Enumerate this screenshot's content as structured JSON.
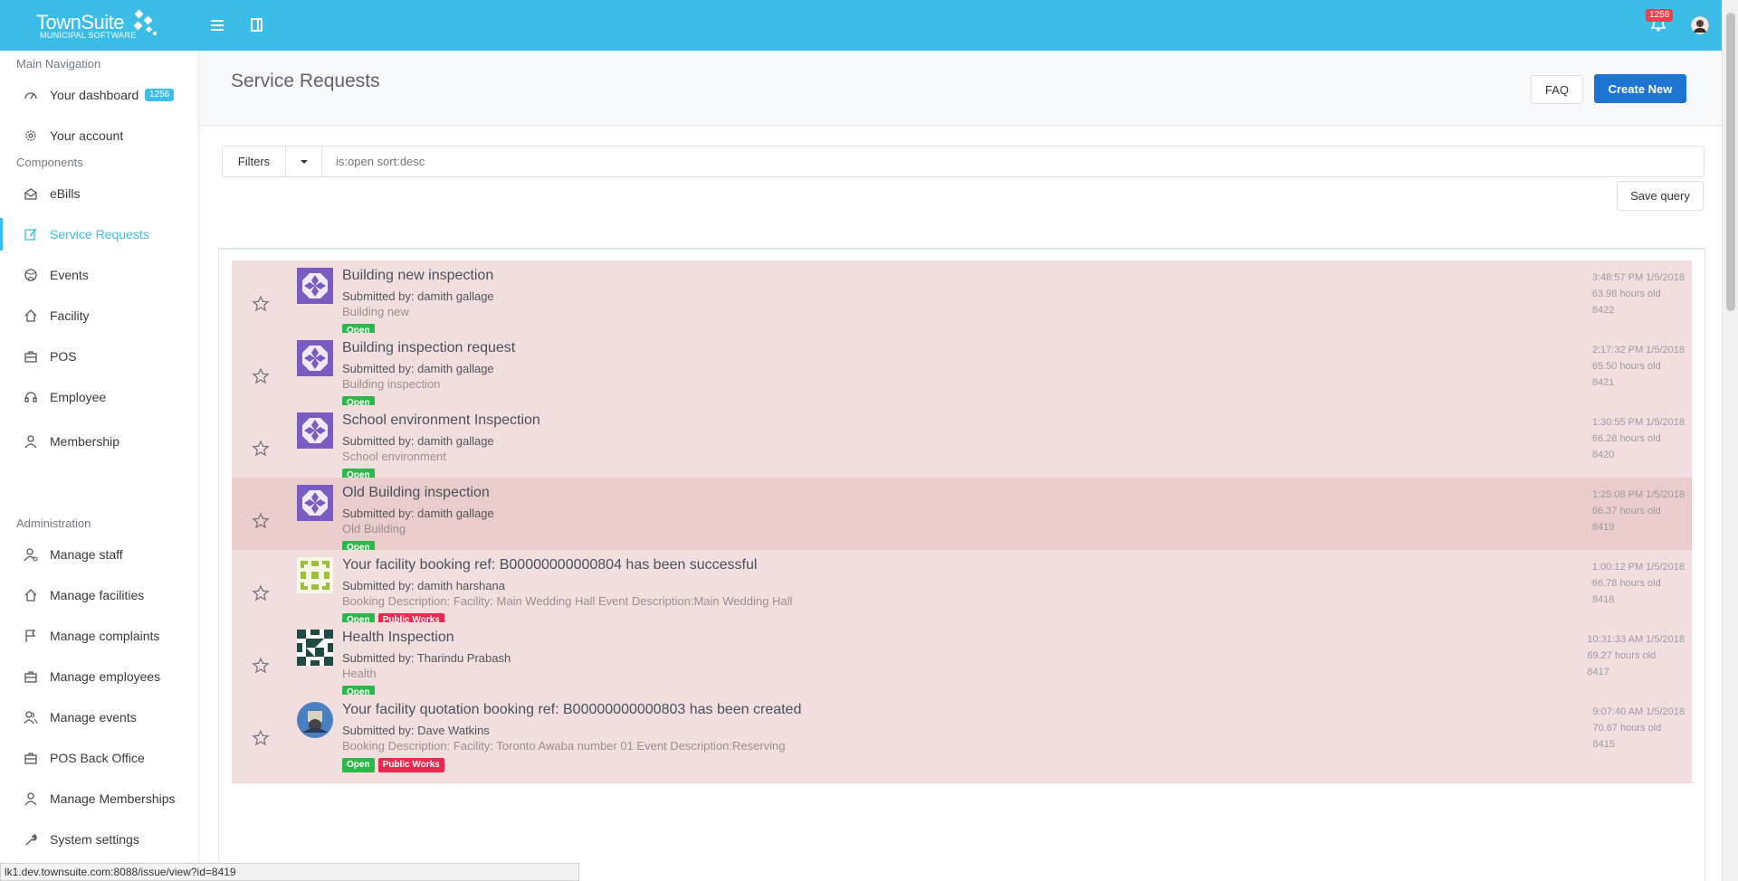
{
  "brand": {
    "name": "TownSuite",
    "tagline": "MUNICIPAL SOFTWARE"
  },
  "topbar": {
    "notifications_count": "1256"
  },
  "sidebar": {
    "sections": [
      {
        "heading": "Main Navigation"
      },
      {
        "heading": "Components"
      },
      {
        "heading": "Administration"
      }
    ],
    "main": [
      {
        "label": "Your dashboard",
        "icon": "dashboard-icon",
        "badge": "1256"
      },
      {
        "label": "Your account",
        "icon": "gear-icon"
      }
    ],
    "components": [
      {
        "label": "eBills",
        "icon": "envelope-icon"
      },
      {
        "label": "Service Requests",
        "icon": "edit-icon",
        "active": true
      },
      {
        "label": "Events",
        "icon": "ball-icon"
      },
      {
        "label": "Facility",
        "icon": "home-icon"
      },
      {
        "label": "POS",
        "icon": "briefcase-icon"
      },
      {
        "label": "Employee",
        "icon": "headset-icon"
      },
      {
        "label": "Membership",
        "icon": "user-icon"
      }
    ],
    "admin": [
      {
        "label": "Manage staff",
        "icon": "user-gear-icon"
      },
      {
        "label": "Manage facilities",
        "icon": "home-icon"
      },
      {
        "label": "Manage complaints",
        "icon": "flag-icon"
      },
      {
        "label": "Manage employees",
        "icon": "briefcase-icon"
      },
      {
        "label": "Manage events",
        "icon": "users-icon"
      },
      {
        "label": "POS Back Office",
        "icon": "briefcase-icon"
      },
      {
        "label": "Manage Memberships",
        "icon": "user-icon"
      },
      {
        "label": "System settings",
        "icon": "wrench-icon"
      }
    ]
  },
  "header": {
    "title": "Service Requests",
    "faq_label": "FAQ",
    "create_label": "Create New"
  },
  "filters": {
    "button_label": "Filters",
    "placeholder": "is:open sort:desc",
    "save_label": "Save query"
  },
  "issues": [
    {
      "title": "Building new inspection",
      "submitted": "Submitted by: damith gallage",
      "desc": "Building new",
      "tags": [
        "Open"
      ],
      "time": "3:48:57 PM 1/5/2018",
      "age": "63.98 hours old",
      "id": "8422",
      "avatar": "purple"
    },
    {
      "title": "Building inspection request",
      "submitted": "Submitted by: damith gallage",
      "desc": "Building inspection",
      "tags": [
        "Open"
      ],
      "time": "2:17:32 PM 1/5/2018",
      "age": "65.50 hours old",
      "id": "8421",
      "avatar": "purple"
    },
    {
      "title": "School environment Inspection",
      "submitted": "Submitted by: damith gallage",
      "desc": "School environment",
      "tags": [
        "Open"
      ],
      "time": "1:30:55 PM 1/5/2018",
      "age": "66.28 hours old",
      "id": "8420",
      "avatar": "purple"
    },
    {
      "title": "Old Building inspection",
      "submitted": "Submitted by: damith gallage",
      "desc": "Old Building",
      "tags": [
        "Open"
      ],
      "time": "1:25:08 PM 1/5/2018",
      "age": "66.37 hours old",
      "id": "8419",
      "avatar": "purple",
      "hover": true
    },
    {
      "title": "Your facility booking ref: B00000000000804 has been successful",
      "submitted": "Submitted by: damith harshana",
      "desc": "Booking Description: Facility: Main Wedding Hall Event Description:Main Wedding Hall",
      "tags": [
        "Open",
        "Public Works"
      ],
      "time": "1:00:12 PM 1/5/2018",
      "age": "66.78 hours old",
      "id": "8418",
      "avatar": "green"
    },
    {
      "title": "Health Inspection",
      "submitted": "Submitted by: Tharindu Prabash",
      "desc": "Health",
      "tags": [
        "Open"
      ],
      "time": "10:31:33 AM 1/5/2018",
      "age": "69.27 hours old",
      "id": "8417",
      "avatar": "dark"
    },
    {
      "title": "Your facility quotation booking ref: B00000000000803 has been created",
      "submitted": "Submitted by: Dave Watkins",
      "desc": "Booking Description: Facility: Toronto Awaba number 01 Event Description:Reserving",
      "tags": [
        "Open",
        "Public Works"
      ],
      "time": "9:07:40 AM 1/5/2018",
      "age": "70.67 hours old",
      "id": "8415",
      "avatar": "photo"
    }
  ],
  "statusbar": {
    "url": "lk1.dev.townsuite.com:8088/issue/view?id=8419"
  },
  "colors": {
    "accent": "#3bbde8",
    "primary": "#1e74d3",
    "open": "#2eb84a",
    "dept": "#e8294f",
    "row": "#f2dede"
  }
}
